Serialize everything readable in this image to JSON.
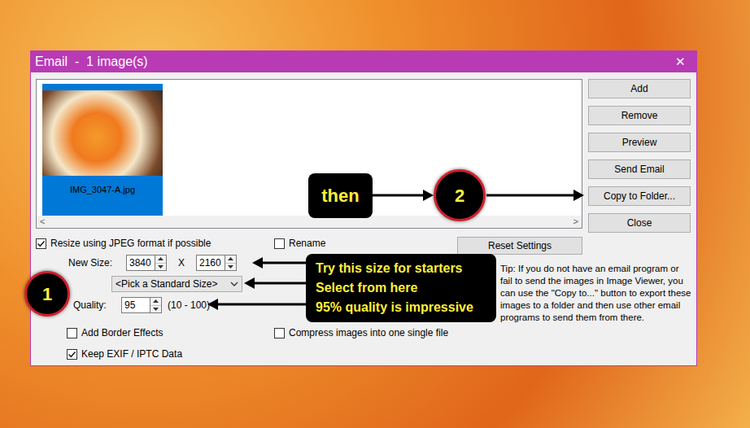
{
  "window": {
    "title": "Email  -  1 image(s)",
    "close": "✕"
  },
  "thumbnails": [
    {
      "filename": "IMG_3047-A.jpg",
      "selected": true
    }
  ],
  "scrollbar": {
    "left": "<",
    "right": ">"
  },
  "buttons": [
    {
      "label": "Add"
    },
    {
      "label": "Remove"
    },
    {
      "label": "Preview"
    },
    {
      "label": "Send Email"
    },
    {
      "label": "Copy to Folder..."
    },
    {
      "label": "Close"
    }
  ],
  "options": {
    "resize": {
      "label": "Resize using JPEG format if possible",
      "checked": true
    },
    "rename": {
      "label": "Rename",
      "checked": false
    },
    "border": {
      "label": "Add Border Effects",
      "checked": false
    },
    "compress": {
      "label": "Compress images into one single file",
      "checked": false
    },
    "exif": {
      "label": "Keep EXIF / IPTC Data",
      "checked": true
    }
  },
  "reset_button": "Reset Settings",
  "new_size": {
    "label": "New Size:",
    "width": "3840",
    "separator": "X",
    "height": "2160"
  },
  "standard_size": {
    "value": "<Pick a Standard Size>"
  },
  "quality": {
    "label": "Quality:",
    "value": "95",
    "range": "(10 - 100)"
  },
  "tip": "Tip: If you do not have an email program or fail to send the images in Image Viewer, you can use the \"Copy to...\" button to export these images to a folder and then use other email programs to send them from there.",
  "annotations": {
    "then": "then",
    "badges": [
      {
        "number": "1"
      },
      {
        "number": "2"
      }
    ],
    "callout_lines": [
      "Try this size for starters",
      "Select from here",
      "95% quality is impressive"
    ]
  }
}
